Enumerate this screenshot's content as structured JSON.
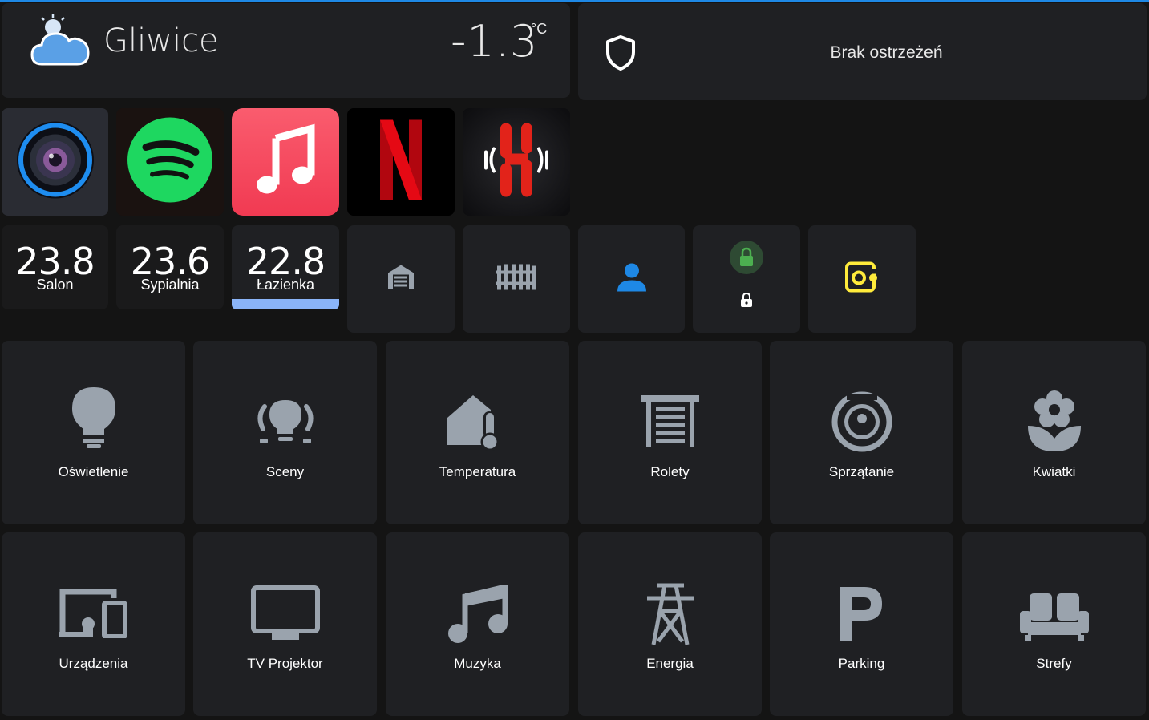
{
  "weather": {
    "city": "Gliwice",
    "temperature": "-1.3",
    "unit": "°C",
    "icon": "cloud-sun-icon"
  },
  "alerts": {
    "text": "Brak ostrzeżeń",
    "icon": "shield-outline-icon"
  },
  "apps": [
    {
      "name": "Camera app",
      "icon": "camera-lens-icon"
    },
    {
      "name": "Spotify",
      "icon": "spotify-icon"
    },
    {
      "name": "Apple Music",
      "icon": "music-note-icon"
    },
    {
      "name": "Netflix",
      "icon": "netflix-icon"
    },
    {
      "name": "Radio app",
      "icon": "radio-waves-icon"
    }
  ],
  "temps": [
    {
      "value": "23.8",
      "name": "Salon"
    },
    {
      "value": "23.6",
      "name": "Sypialnia"
    },
    {
      "value": "22.8",
      "name": "Łazienka"
    }
  ],
  "quick": [
    {
      "icon": "garage-icon"
    },
    {
      "icon": "gate-icon"
    },
    {
      "icon": "person-icon"
    },
    {
      "icon": "lock-icon"
    },
    {
      "icon": "robot-vacuum-icon"
    }
  ],
  "tiles": [
    {
      "label": "Oświetlenie",
      "icon": "lightbulb-icon"
    },
    {
      "label": "Sceny",
      "icon": "scenes-lightbulb-icon"
    },
    {
      "label": "Temperatura",
      "icon": "home-thermometer-icon"
    },
    {
      "label": "Rolety",
      "icon": "roller-shade-icon"
    },
    {
      "label": "Sprzątanie",
      "icon": "robot-vacuum-round-icon"
    },
    {
      "label": "Kwiatki",
      "icon": "flower-icon"
    },
    {
      "label": "Urządzenia",
      "icon": "devices-icon"
    },
    {
      "label": "TV Projektor",
      "icon": "tv-icon"
    },
    {
      "label": "Muzyka",
      "icon": "music-icon"
    },
    {
      "label": "Energia",
      "icon": "transmission-tower-icon"
    },
    {
      "label": "Parking",
      "icon": "parking-icon"
    },
    {
      "label": "Strefy",
      "icon": "sofa-icon"
    }
  ],
  "colors": {
    "card": "#1f2023",
    "background": "#141414",
    "icon_grey": "#9aa3ad",
    "accent_blue": "#1e88e5",
    "bar_blue": "#8ab4f8",
    "vacuum_yellow": "#ffeb3b",
    "lock_green": "#4caf50"
  }
}
